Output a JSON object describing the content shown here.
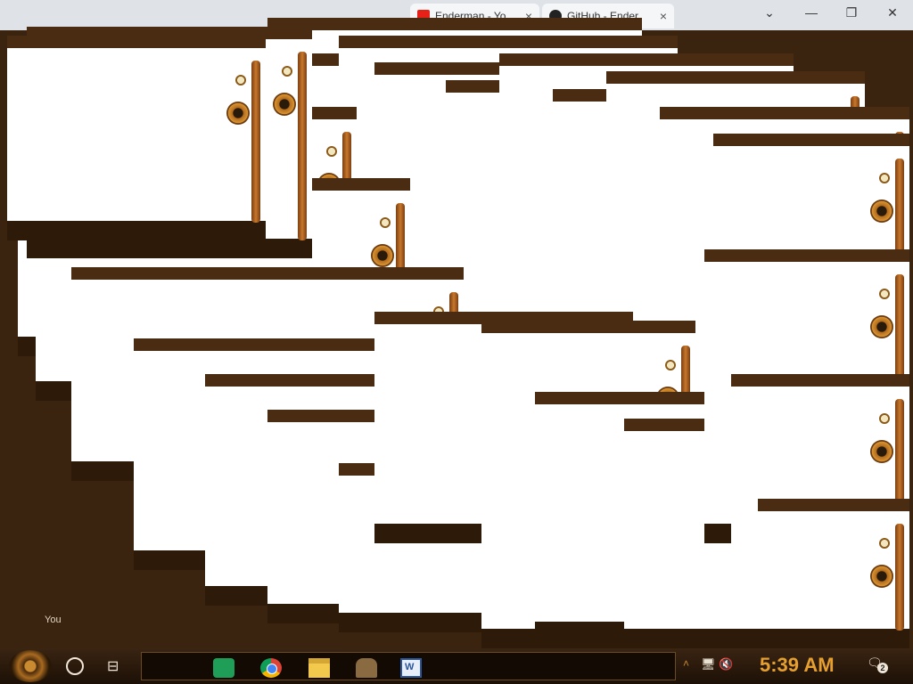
{
  "browser": {
    "tabs": [
      {
        "label": "Enderman - Yo"
      },
      {
        "label": "GitHub - Ender"
      }
    ],
    "close_glyph": "×",
    "dropdown_glyph": "⌄",
    "minimize_glyph": "—",
    "maximize_glyph": "❐",
    "close_window_glyph": "✕"
  },
  "desktop": {
    "stray_label": "You"
  },
  "taskbar": {
    "taskview_glyph": "⊟",
    "apps": [
      "hangouts",
      "chrome",
      "file-explorer",
      "malware-app",
      "word"
    ],
    "tray_glyphs": "🖥 🔇",
    "chevron": "˄",
    "clock": "5:39 AM",
    "notification_glyph": "🗨",
    "notification_count": "2"
  },
  "colors": {
    "wood": "#4a2c12",
    "dark_bar": "#2d1a08",
    "brass": "#d99332",
    "clock_orange": "#e6a030"
  }
}
